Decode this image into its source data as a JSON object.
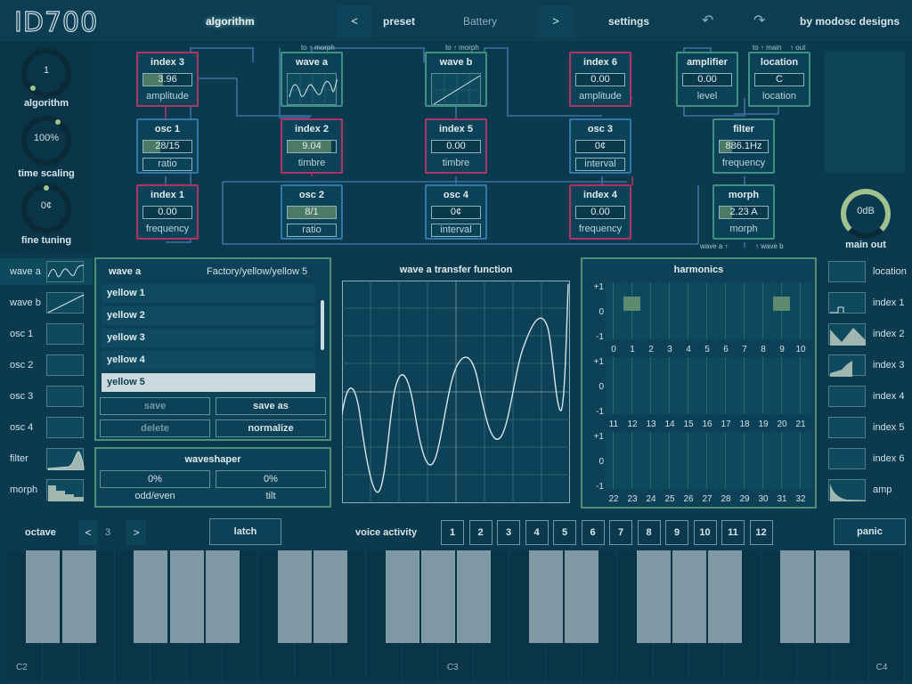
{
  "topbar": {
    "logo": "ID700",
    "algorithm": "algorithm",
    "prev": "<",
    "preset": "preset",
    "preset_name": "Battery",
    "next": ">",
    "settings": "settings",
    "undo": "↶",
    "redo": "↷",
    "credit": "by modosc designs"
  },
  "left_knobs": [
    {
      "value": "1",
      "label": "algorithm"
    },
    {
      "value": "100%",
      "label": "time scaling"
    },
    {
      "value": "0¢",
      "label": "fine tuning"
    }
  ],
  "main_out": {
    "value": "0dB",
    "label": "main out"
  },
  "modules": {
    "index3": {
      "title": "index 3",
      "value": "3.96",
      "sub": "amplitude",
      "fill": 0.4
    },
    "wave_a": {
      "title": "wave a",
      "tag": "to ↑ morph"
    },
    "wave_b": {
      "title": "wave b",
      "tag": "to ↑ morph"
    },
    "index6": {
      "title": "index 6",
      "value": "0.00",
      "sub": "amplitude"
    },
    "amplifier": {
      "title": "amplifier",
      "value": "0.00",
      "sub": "level"
    },
    "location": {
      "title": "location",
      "value": "C",
      "sub": "location",
      "tag_main": "to ↑ main",
      "tag_out": "↑ out"
    },
    "osc1": {
      "title": "osc 1",
      "value": "28/15",
      "sub": "ratio",
      "fill": 0.35
    },
    "index2": {
      "title": "index 2",
      "value": "9.04",
      "sub": "timbre",
      "fill": 0.9
    },
    "index5": {
      "title": "index 5",
      "value": "0.00",
      "sub": "timbre"
    },
    "osc3": {
      "title": "osc 3",
      "value": "0¢",
      "sub": "interval"
    },
    "filter": {
      "title": "filter",
      "value": "886.1Hz",
      "sub": "frequency",
      "fill": 0.25
    },
    "index1": {
      "title": "index 1",
      "value": "0.00",
      "sub": "frequency"
    },
    "osc2": {
      "title": "osc 2",
      "value": "8/1",
      "sub": "ratio",
      "fill": 1.0
    },
    "osc4": {
      "title": "osc 4",
      "value": "0¢",
      "sub": "interval"
    },
    "index4": {
      "title": "index 4",
      "value": "0.00",
      "sub": "frequency"
    },
    "morph": {
      "title": "morph",
      "value": "2.23 A",
      "sub": "morph",
      "tag_a": "wave a ↑",
      "tag_b": "↑ wave b",
      "fill": 0.25
    }
  },
  "left_sidebar": [
    "wave a",
    "wave b",
    "osc 1",
    "osc 2",
    "osc 3",
    "osc 4",
    "filter",
    "morph"
  ],
  "right_sidebar": [
    "location",
    "index 1",
    "index 2",
    "index 3",
    "index 4",
    "index 5",
    "index 6",
    "amp"
  ],
  "preset_panel": {
    "title": "wave a",
    "path": "Factory/yellow/yellow 5",
    "items": [
      "yellow 1",
      "yellow 2",
      "yellow 3",
      "yellow 4",
      "yellow 5"
    ],
    "selected_index": 4,
    "save": "save",
    "save_as": "save as",
    "delete": "delete",
    "normalize": "normalize"
  },
  "waveshaper": {
    "title": "waveshaper",
    "odd_even_value": "0%",
    "odd_even_label": "odd/even",
    "tilt_value": "0%",
    "tilt_label": "tilt"
  },
  "transfer": {
    "title": "wave a transfer function"
  },
  "harmonics": {
    "title": "harmonics",
    "axis": [
      "+1",
      "0",
      "-1"
    ],
    "rows": [
      [
        "0",
        "1",
        "2",
        "3",
        "4",
        "5",
        "6",
        "7",
        "8",
        "9",
        "10"
      ],
      [
        "11",
        "12",
        "13",
        "14",
        "15",
        "16",
        "17",
        "18",
        "19",
        "20",
        "21"
      ],
      [
        "22",
        "23",
        "24",
        "25",
        "26",
        "27",
        "28",
        "29",
        "30",
        "31",
        "32"
      ]
    ],
    "active": [
      1,
      9
    ]
  },
  "keyboard": {
    "octave_label": "octave",
    "octave_prev": "<",
    "octave_value": "3",
    "octave_next": ">",
    "latch": "latch",
    "voice_activity": "voice activity",
    "voices": [
      "1",
      "2",
      "3",
      "4",
      "5",
      "6",
      "7",
      "8",
      "9",
      "10",
      "11",
      "12"
    ],
    "panic": "panic",
    "notes": [
      "C2",
      "C3",
      "C4"
    ]
  }
}
